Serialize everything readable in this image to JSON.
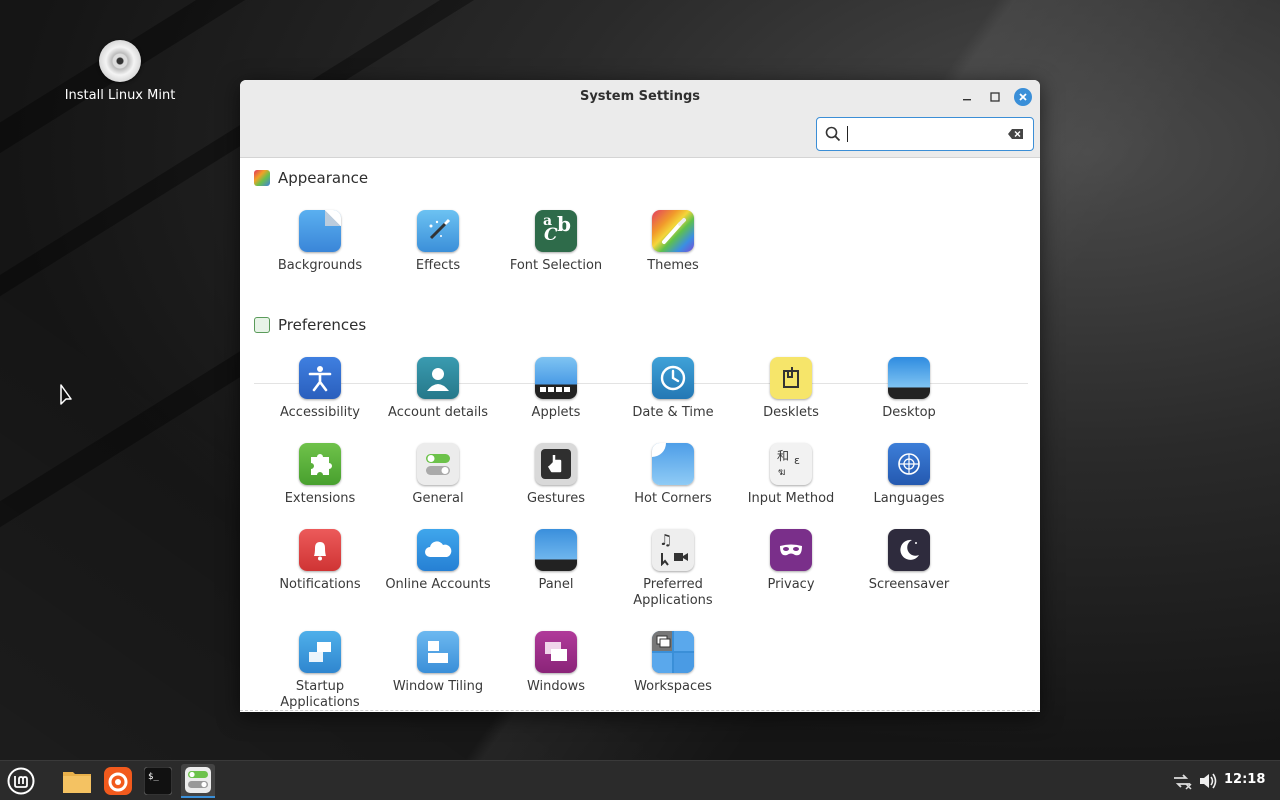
{
  "desktop": {
    "icons": [
      {
        "label": "Install Linux Mint",
        "icon": "cd-icon"
      }
    ]
  },
  "window": {
    "title": "System Settings",
    "controls": {
      "minimize": "–",
      "maximize": "□",
      "close": "✕"
    },
    "search": {
      "value": "",
      "placeholder": ""
    }
  },
  "sections": [
    {
      "title": "Appearance",
      "items": [
        {
          "label": "Backgrounds",
          "icon": "backgrounds-icon"
        },
        {
          "label": "Effects",
          "icon": "effects-icon"
        },
        {
          "label": "Font Selection",
          "icon": "font-selection-icon"
        },
        {
          "label": "Themes",
          "icon": "themes-icon"
        }
      ]
    },
    {
      "title": "Preferences",
      "items": [
        {
          "label": "Accessibility",
          "icon": "accessibility-icon"
        },
        {
          "label": "Account details",
          "icon": "account-details-icon"
        },
        {
          "label": "Applets",
          "icon": "applets-icon"
        },
        {
          "label": "Date & Time",
          "icon": "clock-icon"
        },
        {
          "label": "Desklets",
          "icon": "desklets-icon"
        },
        {
          "label": "Desktop",
          "icon": "desktop-icon"
        },
        {
          "label": "Extensions",
          "icon": "puzzle-icon"
        },
        {
          "label": "General",
          "icon": "toggles-icon"
        },
        {
          "label": "Gestures",
          "icon": "gestures-icon"
        },
        {
          "label": "Hot Corners",
          "icon": "hot-corners-icon"
        },
        {
          "label": "Input Method",
          "icon": "input-method-icon"
        },
        {
          "label": "Languages",
          "icon": "globe-icon"
        },
        {
          "label": "Notifications",
          "icon": "bell-icon"
        },
        {
          "label": "Online Accounts",
          "icon": "cloud-icon"
        },
        {
          "label": "Panel",
          "icon": "panel-icon"
        },
        {
          "label": "Preferred Applications",
          "icon": "preferred-apps-icon"
        },
        {
          "label": "Privacy",
          "icon": "mask-icon"
        },
        {
          "label": "Screensaver",
          "icon": "moon-icon"
        },
        {
          "label": "Startup Applications",
          "icon": "startup-icon"
        },
        {
          "label": "Window Tiling",
          "icon": "window-tiling-icon"
        },
        {
          "label": "Windows",
          "icon": "windows-icon"
        },
        {
          "label": "Workspaces",
          "icon": "workspaces-icon"
        }
      ]
    }
  ],
  "taskbar": {
    "apps": [
      {
        "name": "menu",
        "icon": "mint-menu-icon"
      },
      {
        "name": "files",
        "icon": "folder-icon"
      },
      {
        "name": "firefox",
        "icon": "firefox-icon"
      },
      {
        "name": "terminal",
        "icon": "terminal-icon"
      },
      {
        "name": "settings",
        "icon": "settings-icon",
        "active": true
      }
    ],
    "tray": {
      "network": "network-icon",
      "volume": "volume-icon"
    },
    "clock": "12:18"
  }
}
